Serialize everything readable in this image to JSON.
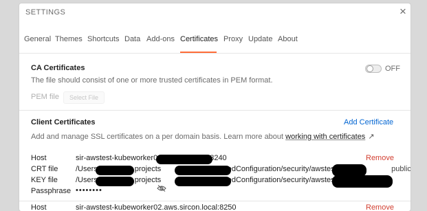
{
  "settings": {
    "title": "SETTINGS",
    "close_symbol": "×",
    "tabs": [
      {
        "label": "General"
      },
      {
        "label": "Themes"
      },
      {
        "label": "Shortcuts"
      },
      {
        "label": "Data"
      },
      {
        "label": "Add-ons"
      },
      {
        "label": "Certificates",
        "active": true
      },
      {
        "label": "Proxy"
      },
      {
        "label": "Update"
      },
      {
        "label": "About"
      }
    ],
    "ca": {
      "title": "CA Certificates",
      "toggle_label": "OFF",
      "toggle_on": false,
      "description": "The file should consist of one or more trusted certificates in PEM format.",
      "pem_label": "PEM file",
      "select_file": "Select File"
    },
    "client": {
      "title": "Client Certificates",
      "add_label": "Add Certificate",
      "description_prefix": "Add and manage SSL certificates on a per domain basis. Learn more about",
      "description_link": "working with certificates",
      "link_arrow": "↗",
      "cert": {
        "host_label": "Host",
        "host_value_start": "sir-awstest-kubeworker0",
        "host_value_end": "8240",
        "remove_label": "Remove",
        "crt_label": "CRT file",
        "crt_part1": "/Users",
        "crt_part2": "projects",
        "crt_part3": "sharedConfiguration/security/awstest/global/",
        "crt_part4": "public.p...",
        "key_label": "KEY file",
        "key_part1": "/Users",
        "key_part2": "projects",
        "key_part3": "sharedConfiguration/security/awstest/global/",
        "key_part4": "...",
        "passphrase_label": "Passphrase",
        "passphrase_value": "••••••••"
      },
      "next_cert": {
        "host_label": "Host",
        "host_value": "sir-awstest-kubeworker02.aws.sircon.local:8250",
        "remove_label": "Remove"
      }
    },
    "colors": {
      "accent": "#ff6c37",
      "link": "#0265d2",
      "danger": "#d23f31"
    },
    "icons": {
      "close": "close-icon",
      "eye": "eye-slash-icon",
      "external_link": "external-link-icon"
    }
  }
}
